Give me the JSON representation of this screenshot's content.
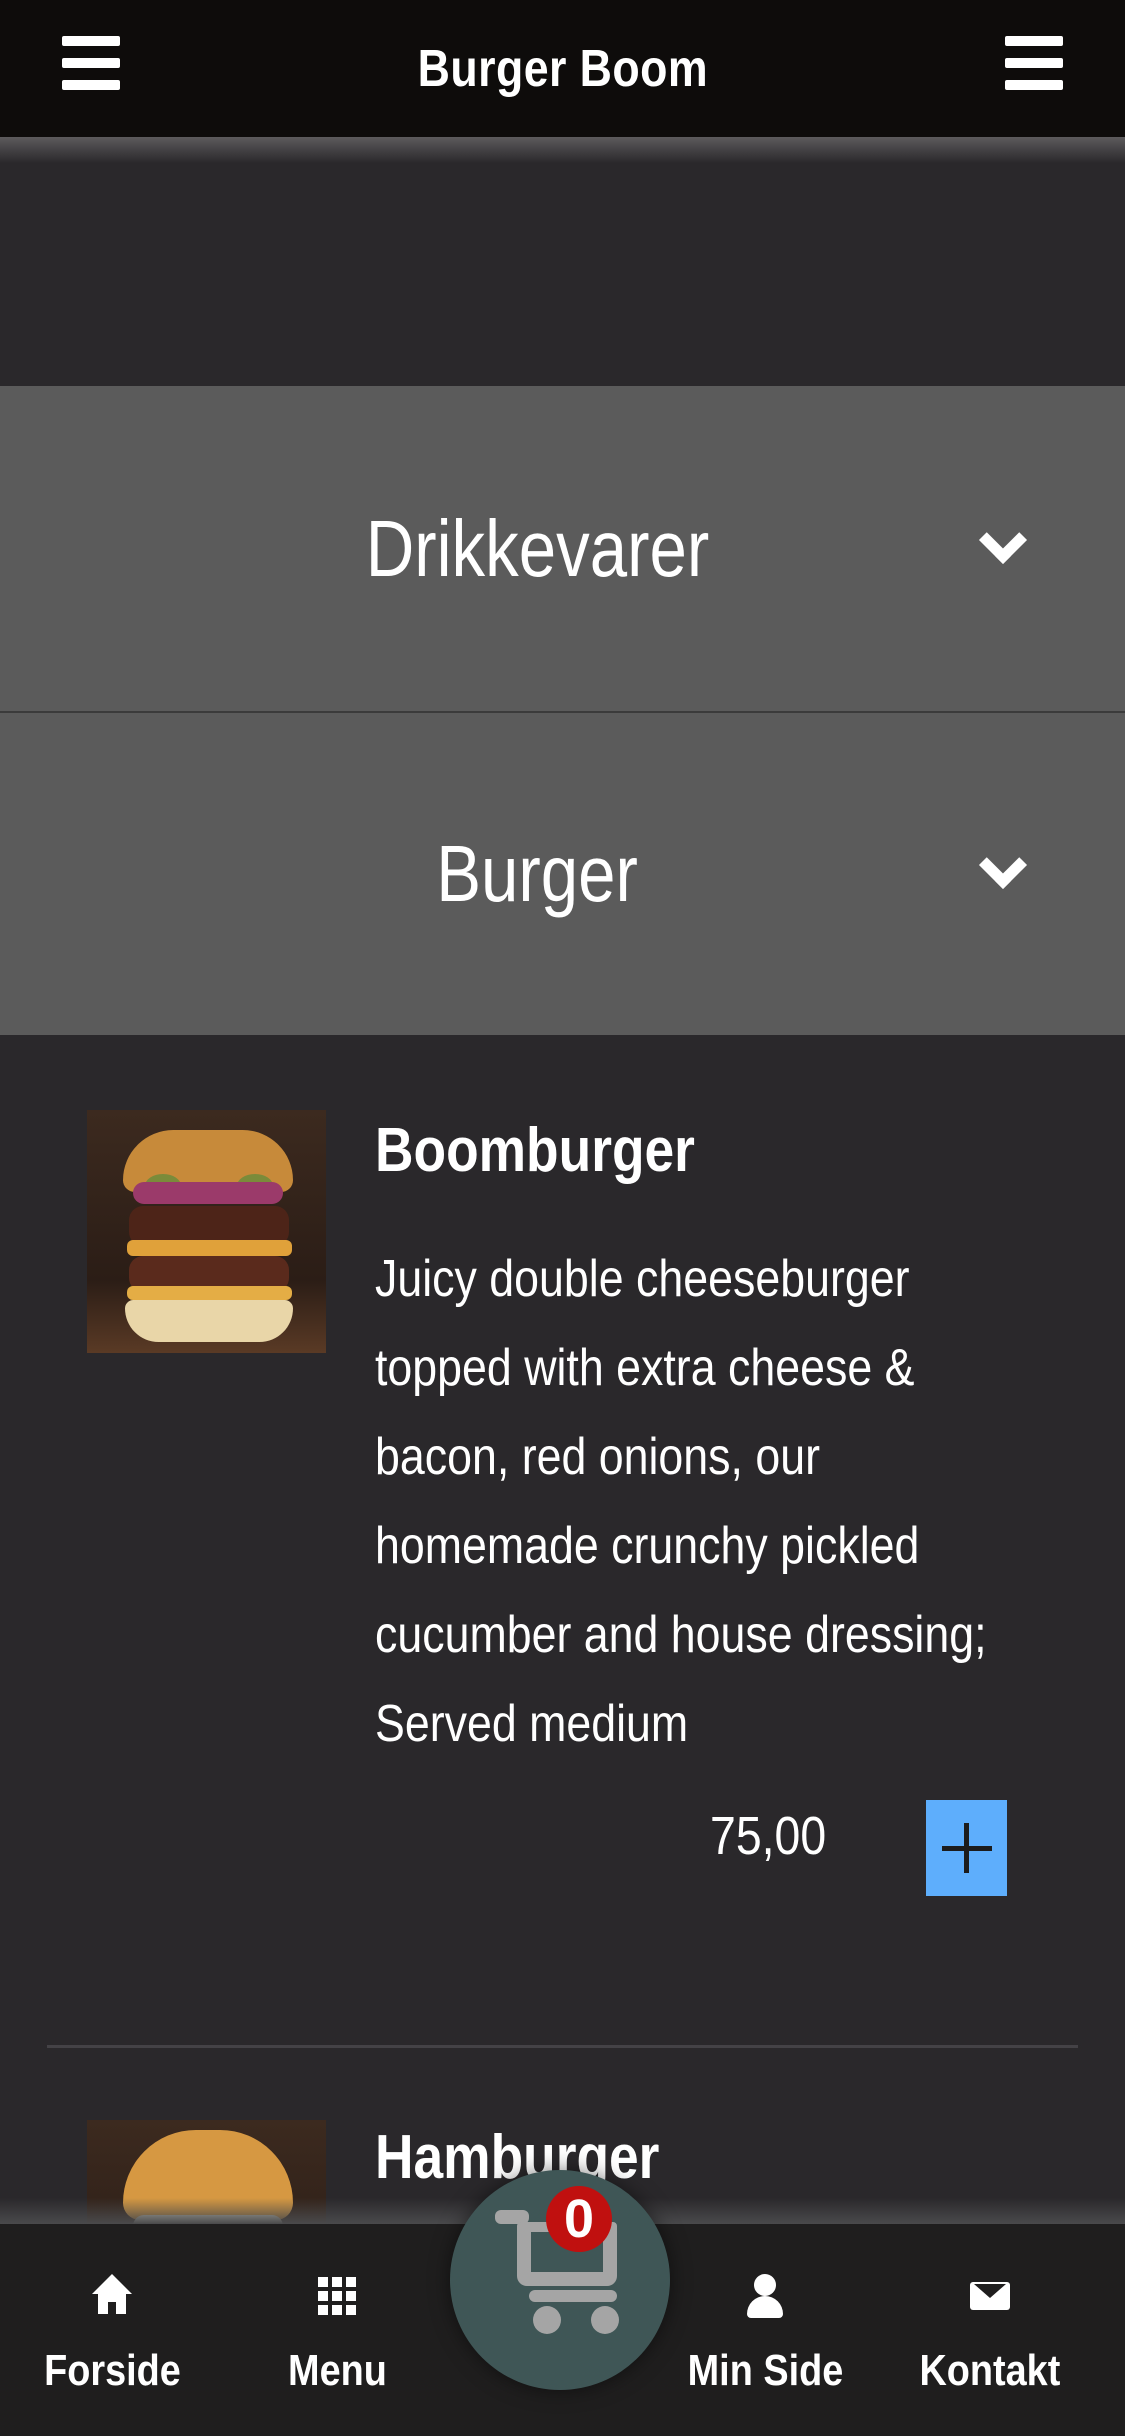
{
  "app": {
    "title": "Burger Boom"
  },
  "categories": [
    {
      "label": "Drikkevarer"
    },
    {
      "label": "Burger"
    }
  ],
  "products": [
    {
      "name": "Boomburger",
      "description": "Juicy double cheeseburger topped with extra cheese & bacon, red onions, our homemade crunchy pickled cucumber and house dressing; Served medium",
      "price": "75,00"
    },
    {
      "name": "Hamburger"
    }
  ],
  "cart": {
    "count": "0"
  },
  "bottom_nav": {
    "forside": "Forside",
    "menu": "Menu",
    "min_side": "Min Side",
    "kontakt": "Kontakt"
  },
  "icons": {
    "left_menu": "hamburger-menu-icon",
    "right_menu": "hamburger-menu-icon",
    "chevron": "chevron-down-icon",
    "add": "plus-icon",
    "home": "home-icon",
    "grid": "grid-icon",
    "cart": "shopping-cart-icon",
    "user": "user-icon",
    "mail": "envelope-icon"
  },
  "colors": {
    "topbar_bg": "#0e0c0b",
    "page_bg": "#2a282b",
    "category_bg": "#5b5b5b",
    "add_button": "#5eaefc",
    "cart_fab": "#3f5656",
    "cart_badge": "#c0100f"
  }
}
